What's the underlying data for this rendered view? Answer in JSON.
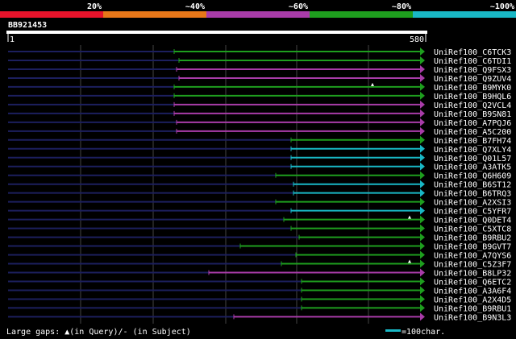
{
  "header": {
    "identity_scale": [
      {
        "label": "20%",
        "color": "#e8132b"
      },
      {
        "label": "~40%",
        "color": "#e87719"
      },
      {
        "label": "~60%",
        "color": "#a93ca9"
      },
      {
        "label": "~80%",
        "color": "#1e9e1e"
      },
      {
        "label": "~100%",
        "color": "#19b8c6"
      }
    ],
    "query_id": "BB921453",
    "query_start": "1",
    "query_end": "580"
  },
  "colors": {
    "background": "#000000",
    "grid": "#444444",
    "unaligned": "#1c1f5e",
    "green": "#1e9e1e",
    "cyan": "#19b8c6",
    "purple": "#a93ca9"
  },
  "hits": [
    {
      "id": "UniRef100_C6TCK3",
      "start": 216,
      "color": "green"
    },
    {
      "id": "UniRef100_C6TDI1",
      "start": 222,
      "color": "green"
    },
    {
      "id": "UniRef100_Q9FSX3",
      "start": 219,
      "color": "purple"
    },
    {
      "id": "UniRef100_Q9ZUV4",
      "start": 222,
      "color": "purple"
    },
    {
      "id": "UniRef100_B9MYK0",
      "start": 216,
      "color": "green",
      "gap_marker": 462
    },
    {
      "id": "UniRef100_B9HQL6",
      "start": 216,
      "color": "green"
    },
    {
      "id": "UniRef100_Q2VCL4",
      "start": 216,
      "color": "purple"
    },
    {
      "id": "UniRef100_B9SN81",
      "start": 216,
      "color": "purple"
    },
    {
      "id": "UniRef100_A7PQJ6",
      "start": 219,
      "color": "purple"
    },
    {
      "id": "UniRef100_A5C200",
      "start": 219,
      "color": "purple"
    },
    {
      "id": "UniRef100_B7FH74",
      "start": 361,
      "color": "green"
    },
    {
      "id": "UniRef100_Q7XLY4",
      "start": 361,
      "color": "cyan"
    },
    {
      "id": "UniRef100_Q01L57",
      "start": 361,
      "color": "cyan"
    },
    {
      "id": "UniRef100_A3ATK5",
      "start": 361,
      "color": "cyan"
    },
    {
      "id": "UniRef100_Q6H609",
      "start": 342,
      "color": "green"
    },
    {
      "id": "UniRef100_B6ST12",
      "start": 364,
      "color": "cyan"
    },
    {
      "id": "UniRef100_B6TRQ3",
      "start": 364,
      "color": "cyan"
    },
    {
      "id": "UniRef100_A2XSI3",
      "start": 342,
      "color": "green"
    },
    {
      "id": "UniRef100_C5YFR7",
      "start": 361,
      "color": "cyan"
    },
    {
      "id": "UniRef100_Q0DET4",
      "start": 352,
      "color": "green",
      "gap_marker": 508
    },
    {
      "id": "UniRef100_C5XTC8",
      "start": 361,
      "color": "green"
    },
    {
      "id": "UniRef100_B9RBU2",
      "start": 371,
      "color": "green"
    },
    {
      "id": "UniRef100_B9GVT7",
      "start": 298,
      "color": "green"
    },
    {
      "id": "UniRef100_A7QYS6",
      "start": 367,
      "color": "green"
    },
    {
      "id": "UniRef100_C5Z3F7",
      "start": 349,
      "color": "green",
      "gap_marker": 508
    },
    {
      "id": "UniRef100_B8LP32",
      "start": 259,
      "color": "purple"
    },
    {
      "id": "UniRef100_Q6ETC2",
      "start": 374,
      "color": "green"
    },
    {
      "id": "UniRef100_A3A6F4",
      "start": 374,
      "color": "green"
    },
    {
      "id": "UniRef100_A2X4D5",
      "start": 374,
      "color": "green"
    },
    {
      "id": "UniRef100_B9RBU1",
      "start": 374,
      "color": "green"
    },
    {
      "id": "UniRef100_B9N3L3",
      "start": 290,
      "color": "purple"
    }
  ],
  "footer": {
    "gaps_legend": "Large gaps: ▲(in Query)/- (in Subject)",
    "scale_legend": "=100char."
  }
}
